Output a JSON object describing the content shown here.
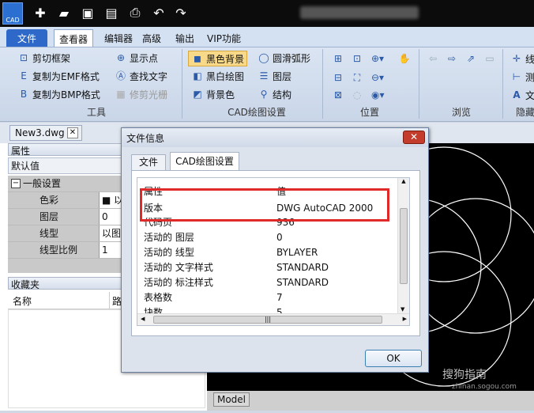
{
  "app": {
    "logo_text": "CAD"
  },
  "quick_access": {
    "icons": [
      "new-icon",
      "open-icon",
      "save-icon",
      "save-pdf-icon",
      "print-icon",
      "undo-icon",
      "redo-icon"
    ]
  },
  "ribbon": {
    "tabs": [
      "文件",
      "查看器",
      "编辑器",
      "高级",
      "输出",
      "VIP功能"
    ],
    "tools": {
      "clip_frame": "剪切框架",
      "copy_emf": "复制为EMF格式",
      "copy_bmp": "复制为BMP格式",
      "show_points": "显示点",
      "find_text": "查找文字",
      "trim_raster": "修剪光栅",
      "label": "工具"
    },
    "cad_settings": {
      "black_bg": "黑色背景",
      "bw_draw": "黑白绘图",
      "bg_color": "背景色",
      "smooth_arc": "圆滑弧形",
      "layers": "图层",
      "structure": "结构",
      "label": "CAD绘图设置"
    },
    "position_label": "位置",
    "browse_label": "浏览",
    "hide_label": "隐藏",
    "right_items": [
      "线",
      "测",
      "文"
    ]
  },
  "document": {
    "tab": "New3.dwg",
    "model_tab": "Model"
  },
  "properties": {
    "header": "属性",
    "default": "默认值",
    "section": "一般设置",
    "rows": [
      {
        "k": "色彩",
        "v": "■ 以"
      },
      {
        "k": "图层",
        "v": "0"
      },
      {
        "k": "线型",
        "v": "以图层"
      },
      {
        "k": "线型比例",
        "v": "1"
      }
    ]
  },
  "favorites": {
    "header": "收藏夹",
    "col_name": "名称",
    "col_path": "路"
  },
  "dialog": {
    "title": "文件信息",
    "tabs": [
      "文件",
      "CAD绘图设置"
    ],
    "headers": {
      "attr": "属性",
      "value": "值"
    },
    "rows": [
      {
        "k": "版本",
        "v": "DWG AutoCAD 2000"
      },
      {
        "k": "代码页",
        "v": "936"
      },
      {
        "k": "活动的 图层",
        "v": "0"
      },
      {
        "k": "活动的 线型",
        "v": "BYLAYER"
      },
      {
        "k": "活动的 文字样式",
        "v": "STANDARD"
      },
      {
        "k": "活动的 标注样式",
        "v": "STANDARD"
      },
      {
        "k": "表格数",
        "v": "7"
      },
      {
        "k": "块数",
        "v": "5"
      }
    ],
    "ok_label": "OK",
    "close_label": "✕"
  },
  "watermark": {
    "line1": "搜狗指南",
    "line2": "zhinan.sogou.com"
  },
  "colors": {
    "accent": "#2e69c9",
    "highlight": "#e02a2a",
    "canvas": "#000000"
  }
}
